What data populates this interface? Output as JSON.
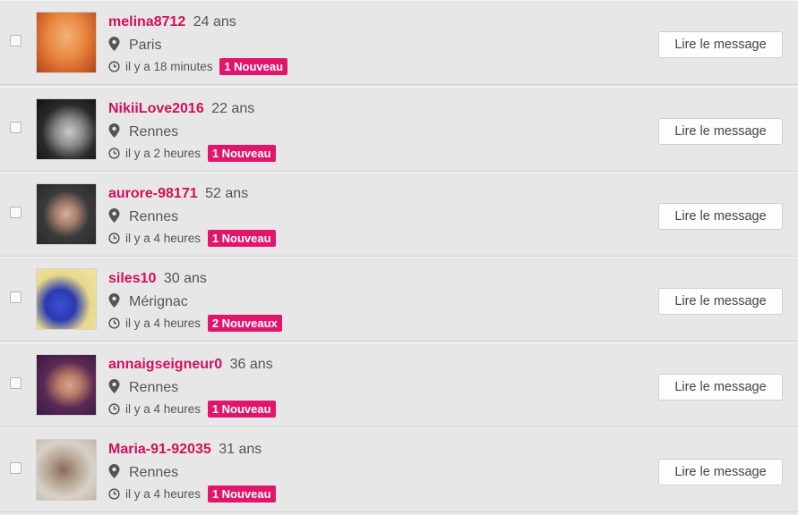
{
  "messages": [
    {
      "username": "melina8712",
      "age": "24 ans",
      "city": "Paris",
      "time": "il y a 18 minutes",
      "badge": "1 Nouveau",
      "button": "Lire le message"
    },
    {
      "username": "NikiiLove2016",
      "age": "22 ans",
      "city": "Rennes",
      "time": "il y a 2 heures",
      "badge": "1 Nouveau",
      "button": "Lire le message"
    },
    {
      "username": "aurore-98171",
      "age": "52 ans",
      "city": "Rennes",
      "time": "il y a 4 heures",
      "badge": "1 Nouveau",
      "button": "Lire le message"
    },
    {
      "username": "siles10",
      "age": "30 ans",
      "city": "Mérignac",
      "time": "il y a 4 heures",
      "badge": "2 Nouveaux",
      "button": "Lire le message"
    },
    {
      "username": "annaigseigneur0",
      "age": "36 ans",
      "city": "Rennes",
      "time": "il y a 4 heures",
      "badge": "1 Nouveau",
      "button": "Lire le message"
    },
    {
      "username": "Maria-91-92035",
      "age": "31 ans",
      "city": "Rennes",
      "time": "il y a 4 heures",
      "badge": "1 Nouveau",
      "button": "Lire le message"
    }
  ],
  "colors": {
    "username": "#d0115a",
    "badge": "#e2156d"
  }
}
